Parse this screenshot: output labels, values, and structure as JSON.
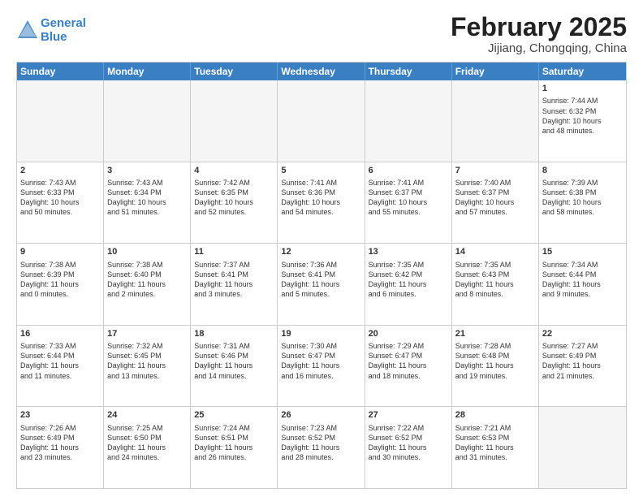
{
  "logo": {
    "line1": "General",
    "line2": "Blue"
  },
  "title": "February 2025",
  "location": "Jijiang, Chongqing, China",
  "weekdays": [
    "Sunday",
    "Monday",
    "Tuesday",
    "Wednesday",
    "Thursday",
    "Friday",
    "Saturday"
  ],
  "weeks": [
    [
      {
        "day": "",
        "info": "",
        "empty": true
      },
      {
        "day": "",
        "info": "",
        "empty": true
      },
      {
        "day": "",
        "info": "",
        "empty": true
      },
      {
        "day": "",
        "info": "",
        "empty": true
      },
      {
        "day": "",
        "info": "",
        "empty": true
      },
      {
        "day": "",
        "info": "",
        "empty": true
      },
      {
        "day": "1",
        "info": "Sunrise: 7:44 AM\nSunset: 6:32 PM\nDaylight: 10 hours\nand 48 minutes.",
        "empty": false
      }
    ],
    [
      {
        "day": "2",
        "info": "Sunrise: 7:43 AM\nSunset: 6:33 PM\nDaylight: 10 hours\nand 50 minutes.",
        "empty": false
      },
      {
        "day": "3",
        "info": "Sunrise: 7:43 AM\nSunset: 6:34 PM\nDaylight: 10 hours\nand 51 minutes.",
        "empty": false
      },
      {
        "day": "4",
        "info": "Sunrise: 7:42 AM\nSunset: 6:35 PM\nDaylight: 10 hours\nand 52 minutes.",
        "empty": false
      },
      {
        "day": "5",
        "info": "Sunrise: 7:41 AM\nSunset: 6:36 PM\nDaylight: 10 hours\nand 54 minutes.",
        "empty": false
      },
      {
        "day": "6",
        "info": "Sunrise: 7:41 AM\nSunset: 6:37 PM\nDaylight: 10 hours\nand 55 minutes.",
        "empty": false
      },
      {
        "day": "7",
        "info": "Sunrise: 7:40 AM\nSunset: 6:37 PM\nDaylight: 10 hours\nand 57 minutes.",
        "empty": false
      },
      {
        "day": "8",
        "info": "Sunrise: 7:39 AM\nSunset: 6:38 PM\nDaylight: 10 hours\nand 58 minutes.",
        "empty": false
      }
    ],
    [
      {
        "day": "9",
        "info": "Sunrise: 7:38 AM\nSunset: 6:39 PM\nDaylight: 11 hours\nand 0 minutes.",
        "empty": false
      },
      {
        "day": "10",
        "info": "Sunrise: 7:38 AM\nSunset: 6:40 PM\nDaylight: 11 hours\nand 2 minutes.",
        "empty": false
      },
      {
        "day": "11",
        "info": "Sunrise: 7:37 AM\nSunset: 6:41 PM\nDaylight: 11 hours\nand 3 minutes.",
        "empty": false
      },
      {
        "day": "12",
        "info": "Sunrise: 7:36 AM\nSunset: 6:41 PM\nDaylight: 11 hours\nand 5 minutes.",
        "empty": false
      },
      {
        "day": "13",
        "info": "Sunrise: 7:35 AM\nSunset: 6:42 PM\nDaylight: 11 hours\nand 6 minutes.",
        "empty": false
      },
      {
        "day": "14",
        "info": "Sunrise: 7:35 AM\nSunset: 6:43 PM\nDaylight: 11 hours\nand 8 minutes.",
        "empty": false
      },
      {
        "day": "15",
        "info": "Sunrise: 7:34 AM\nSunset: 6:44 PM\nDaylight: 11 hours\nand 9 minutes.",
        "empty": false
      }
    ],
    [
      {
        "day": "16",
        "info": "Sunrise: 7:33 AM\nSunset: 6:44 PM\nDaylight: 11 hours\nand 11 minutes.",
        "empty": false
      },
      {
        "day": "17",
        "info": "Sunrise: 7:32 AM\nSunset: 6:45 PM\nDaylight: 11 hours\nand 13 minutes.",
        "empty": false
      },
      {
        "day": "18",
        "info": "Sunrise: 7:31 AM\nSunset: 6:46 PM\nDaylight: 11 hours\nand 14 minutes.",
        "empty": false
      },
      {
        "day": "19",
        "info": "Sunrise: 7:30 AM\nSunset: 6:47 PM\nDaylight: 11 hours\nand 16 minutes.",
        "empty": false
      },
      {
        "day": "20",
        "info": "Sunrise: 7:29 AM\nSunset: 6:47 PM\nDaylight: 11 hours\nand 18 minutes.",
        "empty": false
      },
      {
        "day": "21",
        "info": "Sunrise: 7:28 AM\nSunset: 6:48 PM\nDaylight: 11 hours\nand 19 minutes.",
        "empty": false
      },
      {
        "day": "22",
        "info": "Sunrise: 7:27 AM\nSunset: 6:49 PM\nDaylight: 11 hours\nand 21 minutes.",
        "empty": false
      }
    ],
    [
      {
        "day": "23",
        "info": "Sunrise: 7:26 AM\nSunset: 6:49 PM\nDaylight: 11 hours\nand 23 minutes.",
        "empty": false
      },
      {
        "day": "24",
        "info": "Sunrise: 7:25 AM\nSunset: 6:50 PM\nDaylight: 11 hours\nand 24 minutes.",
        "empty": false
      },
      {
        "day": "25",
        "info": "Sunrise: 7:24 AM\nSunset: 6:51 PM\nDaylight: 11 hours\nand 26 minutes.",
        "empty": false
      },
      {
        "day": "26",
        "info": "Sunrise: 7:23 AM\nSunset: 6:52 PM\nDaylight: 11 hours\nand 28 minutes.",
        "empty": false
      },
      {
        "day": "27",
        "info": "Sunrise: 7:22 AM\nSunset: 6:52 PM\nDaylight: 11 hours\nand 30 minutes.",
        "empty": false
      },
      {
        "day": "28",
        "info": "Sunrise: 7:21 AM\nSunset: 6:53 PM\nDaylight: 11 hours\nand 31 minutes.",
        "empty": false
      },
      {
        "day": "",
        "info": "",
        "empty": true
      }
    ]
  ]
}
